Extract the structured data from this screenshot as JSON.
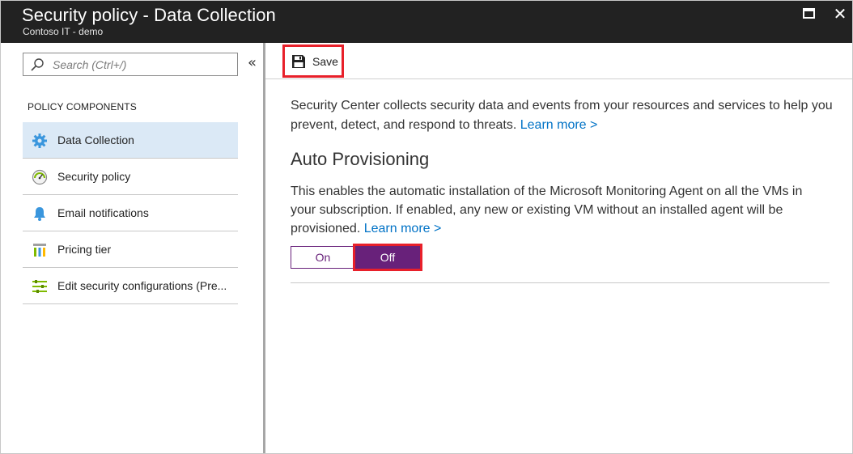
{
  "window": {
    "title": "Security policy - Data Collection",
    "subtitle": "Contoso IT - demo",
    "colors": {
      "titlebar": "#222222",
      "accent_purple": "#68217a",
      "highlight_red": "#e8202a",
      "link_blue": "#0072c6",
      "active_nav": "#dbe9f6"
    },
    "maximize_icon": "maximize-icon",
    "close_icon": "close-icon",
    "close_glyph": "✕"
  },
  "sidebar": {
    "search_placeholder": "Search (Ctrl+/)",
    "collapse_glyph": "«",
    "section_header": "POLICY COMPONENTS",
    "items": [
      {
        "label": "Data Collection",
        "icon": "gear-icon",
        "active": true
      },
      {
        "label": "Security policy",
        "icon": "gauge-icon",
        "active": false
      },
      {
        "label": "Email notifications",
        "icon": "bell-icon",
        "active": false
      },
      {
        "label": "Pricing tier",
        "icon": "pricing-icon",
        "active": false
      },
      {
        "label": "Edit security configurations (Pre...",
        "icon": "sliders-icon",
        "active": false
      }
    ]
  },
  "toolbar": {
    "save_label": "Save",
    "save_icon": "floppy-disk-icon"
  },
  "main": {
    "intro_text": "Security Center collects security data and events from your resources and services to help you prevent, detect, and respond to threats.",
    "intro_link": "Learn more >",
    "heading": "Auto Provisioning",
    "description": "This enables the automatic installation of the Microsoft Monitoring Agent on all the VMs in your subscription. If enabled, any new or existing VM without an installed agent will be provisioned.",
    "description_link": "Learn more >",
    "toggle": {
      "on_label": "On",
      "off_label": "Off",
      "selected": "Off"
    }
  }
}
